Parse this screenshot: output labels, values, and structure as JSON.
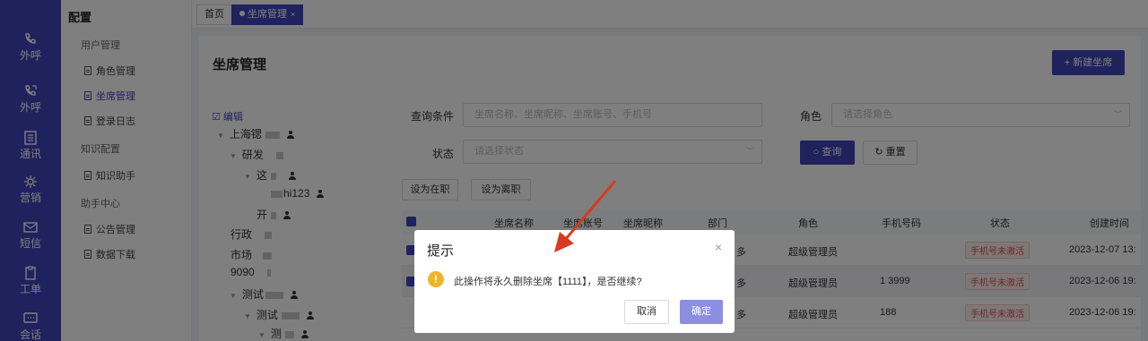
{
  "rail": {
    "items": [
      {
        "label": "外呼",
        "icon": "phone-outgoing-icon"
      },
      {
        "label": "外呼",
        "icon": "phone-forward-icon"
      },
      {
        "label": "通讯",
        "icon": "address-book-icon"
      },
      {
        "label": "营销",
        "icon": "marketing-icon"
      },
      {
        "label": "短信",
        "icon": "message-icon"
      },
      {
        "label": "工单",
        "icon": "clipboard-icon"
      },
      {
        "label": "会话",
        "icon": "chat-icon"
      }
    ]
  },
  "sidebar": {
    "title": "配置",
    "groups": {
      "user": "用户管理",
      "knowledge": "知识配置",
      "assistant": "助手中心"
    },
    "links": {
      "roles": "角色管理",
      "agents": "坐席管理",
      "login_log": "登录日志",
      "knowledge_helper": "知识助手",
      "notices": "公告管理",
      "downloads": "数据下载"
    }
  },
  "tabs": {
    "home": "首页",
    "agents": "坐席管理",
    "close": "×"
  },
  "page": {
    "title": "坐席管理",
    "new_button": "+ 新建坐席"
  },
  "tree": {
    "edit": "编辑",
    "nodes": {
      "n1": "上海锶",
      "n2": "研发",
      "n3": "这",
      "n4": "hi123",
      "n5": "开",
      "n6": "行政",
      "n7": "市场",
      "n8": "9090",
      "n9": "测试",
      "n10": "测试",
      "n11": "测"
    }
  },
  "filters": {
    "query_label": "查询条件",
    "query_placeholder": "坐席名称、坐席昵称、坐席账号、手机号",
    "role_label": "角色",
    "role_placeholder": "请选择角色",
    "status_label": "状态",
    "status_placeholder": "请选择状态",
    "search_button": "查询",
    "reset_button": "重置",
    "set_active": "设为在职",
    "set_left": "设为离职"
  },
  "table": {
    "headers": {
      "name": "坐席名称",
      "account": "坐席账号",
      "nickname": "坐席昵称",
      "dept": "部门",
      "role": "角色",
      "phone": "手机号码",
      "status": "状态",
      "created": "创建时间"
    },
    "rows": [
      {
        "dept": "多",
        "role": "超级管理员",
        "phone": "",
        "status": "手机号未激活",
        "created": "2023-12-07 13:"
      },
      {
        "dept": "多",
        "role": "超级管理员",
        "phone": "1 3999",
        "status": "手机号未激活",
        "created": "2023-12-06 19:"
      },
      {
        "dept": "多",
        "role": "超级管理员",
        "phone": "188",
        "status": "手机号未激活",
        "created": "2023-12-06 19:"
      }
    ]
  },
  "dialog": {
    "title": "提示",
    "close": "×",
    "warn_icon": "!",
    "message": "此操作将永久删除坐席【1111】，是否继续?",
    "cancel": "取消",
    "confirm": "确定"
  },
  "colors": {
    "brand": "#3f44b8",
    "warning": "#f0b429",
    "danger": "#e05050",
    "arrow": "#d63a1f"
  }
}
